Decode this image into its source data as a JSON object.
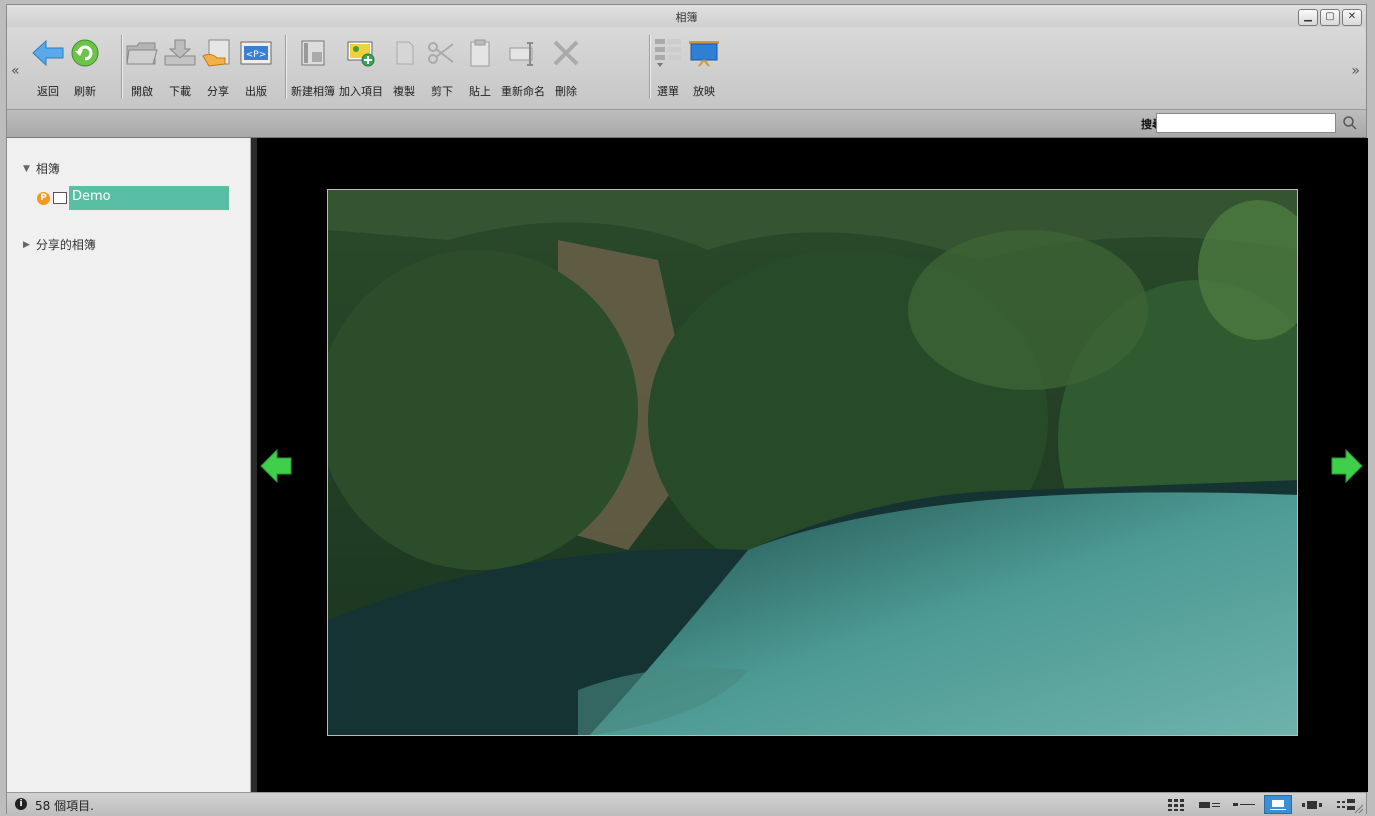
{
  "window": {
    "title": "相簿",
    "controls": [
      "minimize-icon",
      "maximize-icon",
      "close-icon"
    ]
  },
  "toolbar": {
    "left_arrow": "«",
    "right_arrow": "»",
    "groups": [
      [
        {
          "id": "back",
          "label": "返回"
        },
        {
          "id": "refresh",
          "label": "刷新"
        }
      ],
      [
        {
          "id": "open",
          "label": "開啟"
        },
        {
          "id": "download",
          "label": "下載"
        },
        {
          "id": "share",
          "label": "分享"
        },
        {
          "id": "publish",
          "label": "出版"
        }
      ],
      [
        {
          "id": "new-album",
          "label": "新建相簿"
        },
        {
          "id": "add-items",
          "label": "加入項目"
        },
        {
          "id": "copy",
          "label": "複製"
        },
        {
          "id": "cut",
          "label": "剪下"
        },
        {
          "id": "paste",
          "label": "貼上"
        },
        {
          "id": "rename",
          "label": "重新命名"
        },
        {
          "id": "delete",
          "label": "刪除"
        }
      ],
      [
        {
          "id": "menu",
          "label": "選單"
        },
        {
          "id": "slideshow",
          "label": "放映"
        }
      ]
    ]
  },
  "search": {
    "label": "搜尋",
    "value": "",
    "placeholder": ""
  },
  "sidebar": {
    "albums_label": "相簿",
    "albums_expanded": true,
    "items": [
      {
        "name": "Demo",
        "badge": "P",
        "selected": true
      }
    ],
    "shared_label": "分享的相簿",
    "shared_expanded": false
  },
  "status": {
    "text": "58 個項目.",
    "info_icon": "i"
  },
  "colors": {
    "selection": "#59bfa4",
    "nav_arrow": "#3fcf4a",
    "viewer_bg": "#000000"
  },
  "views": [
    "thumbnail-view-icon",
    "list-view-icon",
    "detail-view-icon",
    "preview-view-icon",
    "filmstrip-view-icon",
    "small-icon-view-icon"
  ],
  "active_view": 3
}
